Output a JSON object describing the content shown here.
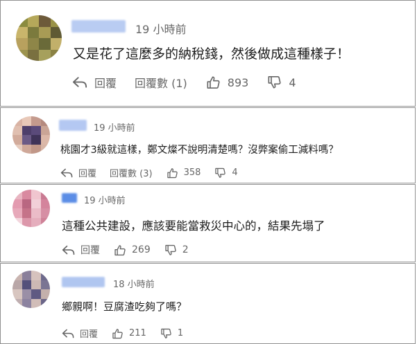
{
  "comments": [
    {
      "time": "19 小時前",
      "text": "又是花了這麼多的納稅錢，然後做成這種樣子！",
      "reply_label": "回覆",
      "reply_count_label": "回覆數 (1)",
      "likes": "893",
      "dislikes": "4",
      "avatar_colors": [
        "#8a8b3f",
        "#b5a85a",
        "#6d5a3a",
        "#9a9348",
        "#c9b56b",
        "#7b7a3d",
        "#a89b55",
        "#5f5a34",
        "#b8a15e",
        "#8e8648",
        "#6a6a39",
        "#c2b06a",
        "#9d944f",
        "#7a7040",
        "#a6a05c",
        "#8b8244"
      ],
      "name_color": "#b9ccf2"
    },
    {
      "time": "19 小時前",
      "text": "桃園才3級就這樣，鄭文燦不說明清楚嗎？沒弊案偷工減料嗎？",
      "reply_label": "回覆",
      "reply_count_label": "回覆數 (3)",
      "likes": "358",
      "dislikes": "4",
      "avatar_colors": [
        "#d9b3a4",
        "#e8c8b8",
        "#c49a8d",
        "#b58a7e",
        "#e0bfb0",
        "#4e3f6b",
        "#5a4a7a",
        "#caa596",
        "#d2ab9b",
        "#6b5a86",
        "#3f3358",
        "#dcb8a8",
        "#e6cbbd",
        "#cfa899",
        "#c19788",
        "#d8b5a5"
      ],
      "name_color": "#b4c8f2"
    },
    {
      "time": "19 小時前",
      "text": "這種公共建設，應該要能當救災中心的，結果先塌了",
      "reply_label": "回覆",
      "likes": "269",
      "dislikes": "2",
      "avatar_colors": [
        "#e8b5c1",
        "#d98aa0",
        "#f0c5cf",
        "#c97a92",
        "#e39bb0",
        "#b96781",
        "#f2d0d8",
        "#d4849c",
        "#e7a9ba",
        "#c57389",
        "#ebbcc8",
        "#d68fa4",
        "#f3d6dd",
        "#dc97aa",
        "#e5aebd",
        "#cf8298"
      ],
      "name_color": "#5b8de6"
    },
    {
      "time": "18 小時前",
      "text": "鄉親啊！豆腐渣吃夠了嗎？",
      "reply_label": "回覆",
      "likes": "211",
      "dislikes": "1",
      "avatar_colors": [
        "#c9b4b0",
        "#8a7f9a",
        "#d6c2bd",
        "#6e6a8c",
        "#b9a7a8",
        "#54507a",
        "#cdb9b4",
        "#7b7593",
        "#d8c6c0",
        "#9a8fa6",
        "#5f5a82",
        "#c4b0ac",
        "#bfaeb0",
        "#8c83a0",
        "#d1bdb8",
        "#6a6588"
      ],
      "name_color": "#b0c6f0"
    }
  ]
}
